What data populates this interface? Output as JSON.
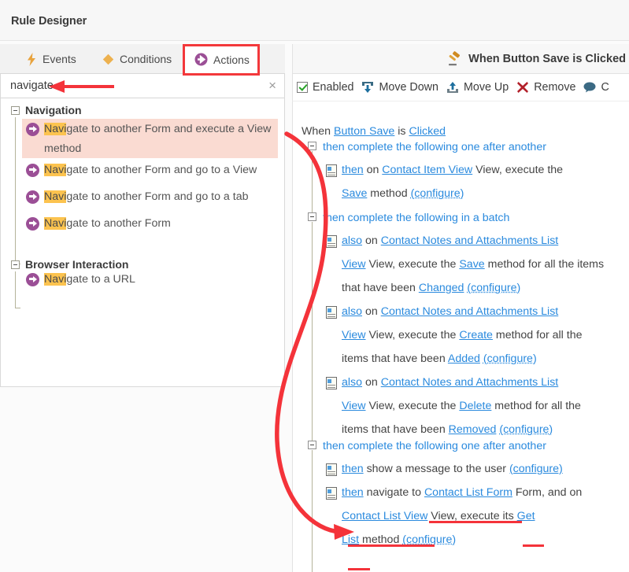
{
  "window": {
    "title": "Rule Designer"
  },
  "tabs": [
    {
      "id": "events",
      "label": "Events",
      "icon": "lightning-bolt-icon",
      "active": false
    },
    {
      "id": "conditions",
      "label": "Conditions",
      "icon": "diamond-icon",
      "active": false
    },
    {
      "id": "actions",
      "label": "Actions",
      "icon": "arrow-circle-icon",
      "active": true
    }
  ],
  "search": {
    "value": "navigate",
    "placeholder": "",
    "clear_label": "×"
  },
  "tree": {
    "groups": [
      {
        "label": "Navigation",
        "items": [
          {
            "highlight": "Navi",
            "rest": "gate to another Form and execute a View method",
            "selected": true
          },
          {
            "highlight": "Navi",
            "rest": "gate to another Form and go to a View",
            "selected": false
          },
          {
            "highlight": "Navi",
            "rest": "gate to another Form and go to a tab",
            "selected": false
          },
          {
            "highlight": "Navi",
            "rest": "gate to another Form",
            "selected": false
          }
        ]
      },
      {
        "label": "Browser Interaction",
        "items": [
          {
            "highlight": "Navi",
            "rest": "gate to a URL",
            "selected": false
          }
        ]
      }
    ]
  },
  "right": {
    "header_title": "When Button Save is Clicked",
    "header_icon": "gavel-icon",
    "toolbar": [
      {
        "id": "enabled",
        "label": "Enabled",
        "icon": "checkbox-checked-icon"
      },
      {
        "id": "move-down",
        "label": "Move Down",
        "icon": "move-down-icon"
      },
      {
        "id": "move-up",
        "label": "Move Up",
        "icon": "move-up-icon"
      },
      {
        "id": "remove",
        "label": "Remove",
        "icon": "red-x-icon"
      },
      {
        "id": "comment",
        "label": "C",
        "icon": "comment-bubble-icon"
      }
    ],
    "rule": {
      "when_prefix": "When ",
      "when_subject": "Button Save",
      "when_mid": " is ",
      "when_event": "Clicked",
      "grp1_label": "then complete the following one after another",
      "a1_kw": "then",
      "a1_t1": " on ",
      "a1_view": "Contact Item View",
      "a1_t2": " View, execute the",
      "a1_method": "Save",
      "a1_t3": " method ",
      "a1_cfg": "(configure)",
      "grp2_label": "then complete the following in a batch",
      "a2_kw": "also",
      "a2_t1": " on ",
      "a2_view1": "Contact Notes and Attachments List",
      "a2_view2": "View",
      "a2_t2": " View, execute the ",
      "a2_method": "Save",
      "a2_t3": " method for all the items",
      "a2_t4": "that have been ",
      "a2_state": "Changed",
      "a2_cfg": "(configure)",
      "a3_kw": "also",
      "a3_t1": " on ",
      "a3_view1": "Contact Notes and Attachments List",
      "a3_view2": "View",
      "a3_t2": " View, execute the ",
      "a3_method": "Create",
      "a3_t3": " method for all the",
      "a3_t4": "items that have been ",
      "a3_state": "Added",
      "a3_cfg": "(configure)",
      "a4_kw": "also",
      "a4_t1": " on ",
      "a4_view1": "Contact Notes and Attachments List",
      "a4_view2": "View",
      "a4_t2": " View, execute the ",
      "a4_method": "Delete",
      "a4_t3": " method for all the",
      "a4_t4": "items that have been ",
      "a4_state": "Removed",
      "a4_cfg": "(configure)",
      "grp3_label": "then complete the following one after another",
      "a5_kw": "then",
      "a5_t1": " show a message to the user ",
      "a5_cfg": "(configure)",
      "a6_kw": "then",
      "a6_t1": " navigate to ",
      "a6_form": "Contact List Form",
      "a6_t2": " Form, and on",
      "a6_view": "Contact List View",
      "a6_t3": " View, execute its ",
      "a6_method1": "Get",
      "a6_method2": "List",
      "a6_t4": " method ",
      "a6_cfg": "(configure)"
    }
  },
  "annotations": {
    "accent_red": "#f4333a",
    "highlight_yellow": "#fcc34f",
    "selection_pink": "#fadbd2",
    "link_blue": "#2a8ade",
    "purple": "#9b4f96"
  }
}
